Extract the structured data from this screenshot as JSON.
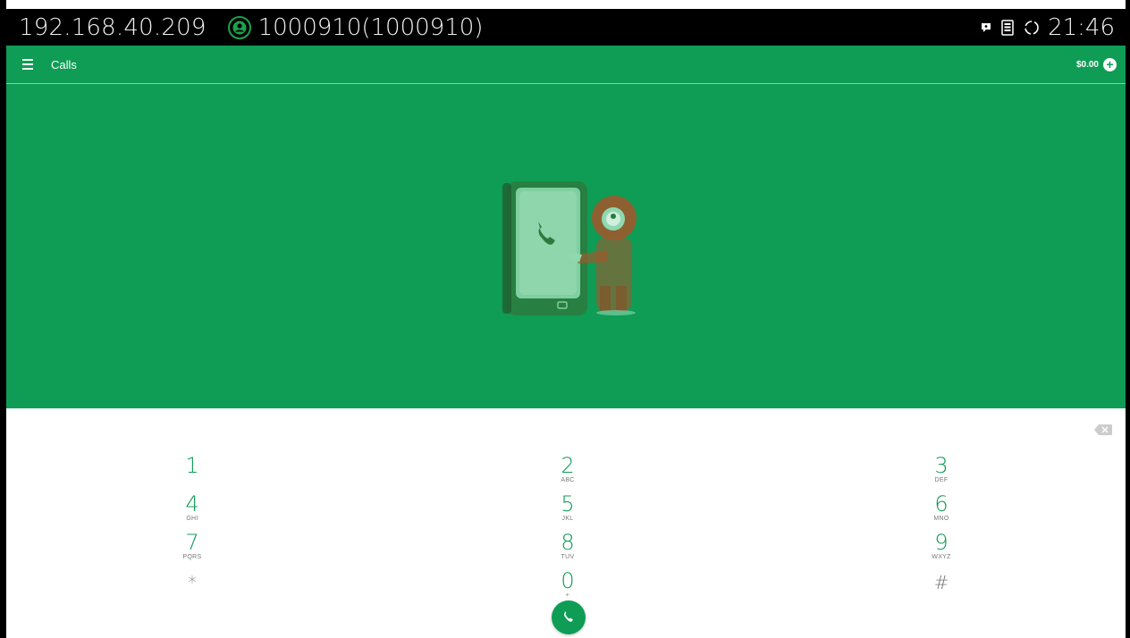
{
  "status_bar": {
    "ip": "192.168.40.209",
    "account": "1000910(1000910)",
    "time": "21:46",
    "icons": [
      "chat-icon",
      "sim-card-icon",
      "sync-icon"
    ]
  },
  "app_bar": {
    "title": "Calls",
    "balance": "$0.00",
    "add_label": "+"
  },
  "dialpad": {
    "keys": [
      {
        "digit": "1",
        "letters": ""
      },
      {
        "digit": "2",
        "letters": "ABC"
      },
      {
        "digit": "3",
        "letters": "DEF"
      },
      {
        "digit": "4",
        "letters": "GHI"
      },
      {
        "digit": "5",
        "letters": "JKL"
      },
      {
        "digit": "6",
        "letters": "MNO"
      },
      {
        "digit": "7",
        "letters": "PQRS"
      },
      {
        "digit": "8",
        "letters": "TUV"
      },
      {
        "digit": "9",
        "letters": "WXYZ"
      },
      {
        "digit": "*",
        "letters": ""
      },
      {
        "digit": "0",
        "letters": "+"
      },
      {
        "digit": "#",
        "letters": ""
      }
    ]
  },
  "colors": {
    "primary_green": "#0f9c55",
    "status_bar": "#000000"
  }
}
